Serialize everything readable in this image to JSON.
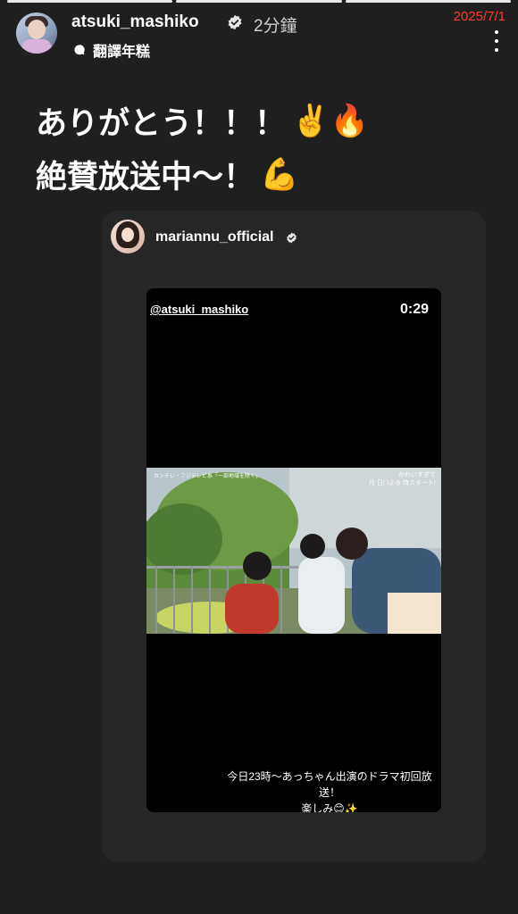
{
  "story": {
    "progress_segments": 3,
    "progress_active": 3
  },
  "header": {
    "username": "atsuki_mashiko",
    "time_ago": "2分鐘",
    "translate_label": "翻譯年糕",
    "date_stamp": "2025/7/1",
    "avatar_icon": "profile-avatar",
    "more_icon": "more-vertical-icon"
  },
  "caption": {
    "line1": "ありがとう！！！",
    "line1_emoji": "✌️🔥",
    "line2": "絶賛放送中〜！",
    "line2_emoji": "💪"
  },
  "shared_post": {
    "username": "mariannu_official",
    "video": {
      "mention": "@atsuki_mashiko",
      "timestamp": "0:29",
      "overlay_left": "カンテレ・フジテレビ系「一部地域を除く」",
      "overlay_title_1": "かわいすぎて",
      "overlay_title_2": "月 日( )よる 時スタート!",
      "subtitle_line1": "今日23時〜あっちゃん出演のドラマ初回放送！",
      "subtitle_line2": "楽しみ😊✨"
    }
  },
  "colors": {
    "background": "#1f1f1f",
    "card": "#262626",
    "date_stamp": "#ff3a2e"
  }
}
